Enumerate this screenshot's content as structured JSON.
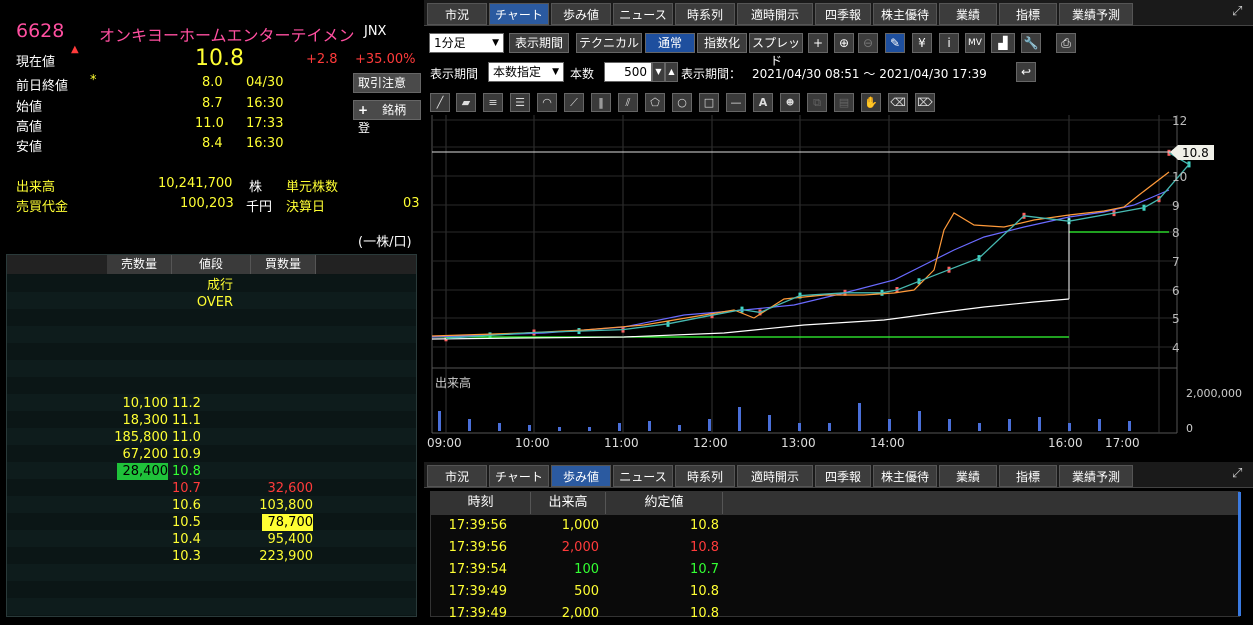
{
  "quote": {
    "code": "6628",
    "name": "オンキヨーホームエンターテイメン",
    "market": "JNX",
    "current_label": "現在値",
    "current": "10.8",
    "change": "+2.8",
    "change_pct": "+35.00%",
    "prev_close_label": "前日終値",
    "prev_mark": "*",
    "prev_close": "8.0",
    "prev_close_date": "04/30",
    "open_label": "始値",
    "open": "8.7",
    "open_time": "16:30",
    "high_label": "高値",
    "high": "11.0",
    "high_time": "17:33",
    "low_label": "安値",
    "low": "8.4",
    "low_time": "16:30",
    "volume_label": "出来高",
    "volume": "10,241,700",
    "volume_unit": "株",
    "unit_shares_label": "単元株数",
    "turnover_label": "売買代金",
    "turnover": "100,203",
    "turnover_unit": "千円",
    "settlement_label": "決算日",
    "settlement_val": "03",
    "unit_note": "(一株/口)",
    "btn_notice": "取引注意",
    "btn_register": "銘柄登",
    "btn_plus": "+"
  },
  "board": {
    "headers": [
      "売数量",
      "値段",
      "買数量"
    ],
    "market_order": "成行",
    "over": "OVER",
    "asks": [
      {
        "qty": "10,100",
        "price": "11.2"
      },
      {
        "qty": "18,300",
        "price": "11.1"
      },
      {
        "qty": "185,800",
        "price": "11.0"
      },
      {
        "qty": "67,200",
        "price": "10.9"
      },
      {
        "qty": "28,400",
        "price": "10.8"
      }
    ],
    "bids": [
      {
        "price": "10.7",
        "qty": "32,600"
      },
      {
        "price": "10.6",
        "qty": "103,800"
      },
      {
        "price": "10.5",
        "qty": "78,700"
      },
      {
        "price": "10.4",
        "qty": "95,400"
      },
      {
        "price": "10.3",
        "qty": "223,900"
      }
    ]
  },
  "tabs": [
    "市況",
    "チャート",
    "歩み値",
    "ニュース",
    "時系列",
    "適時開示",
    "四季報",
    "株主優待",
    "業績",
    "指標",
    "業績予測"
  ],
  "toolbar": {
    "interval": "1分足",
    "period_btn": "表示期間",
    "technical_btn": "テクニカル",
    "normal_btn": "通常",
    "index_btn": "指数化",
    "spread_btn": "スプレッド",
    "period_label": "表示期間",
    "period_mode": "本数指定",
    "count_label": "本数",
    "count": "500",
    "range_label": "表示期間：",
    "range": "2021/04/30 08:51 ～ 2021/04/30 17:39"
  },
  "chart": {
    "yticks": [
      "12",
      "10",
      "9",
      "8",
      "7",
      "6",
      "5",
      "4"
    ],
    "current_tag": "10.8",
    "volume_label": "出来高",
    "volume_tick": "2,000,000",
    "volume_zero": "0",
    "xticks": [
      "09:00",
      "10:00",
      "11:00",
      "12:00",
      "13:00",
      "14:00",
      "16:00",
      "17:00"
    ]
  },
  "chart_data": {
    "type": "line",
    "title": "",
    "xlabel": "",
    "ylabel": "",
    "x": [
      "09:00",
      "09:30",
      "10:00",
      "10:30",
      "11:00",
      "11:30",
      "12:00",
      "12:20",
      "12:35",
      "13:00",
      "13:30",
      "13:55",
      "14:05",
      "14:20",
      "14:40",
      "15:00",
      "15:30",
      "16:00",
      "16:30",
      "16:50",
      "17:00",
      "17:20",
      "17:39"
    ],
    "series": [
      {
        "values": [
          4.3,
          4.4,
          4.5,
          4.55,
          4.6,
          4.8,
          5.1,
          5.3,
          5.2,
          5.8,
          5.9,
          5.9,
          6.0,
          6.3,
          6.7,
          7.1,
          8.6,
          8.4,
          8.7,
          8.9,
          9.2,
          10.4,
          10.8
        ]
      }
    ],
    "ylim": [
      4,
      12
    ]
  },
  "ticks": {
    "headers": [
      "時刻",
      "出来高",
      "約定値"
    ],
    "rows": [
      {
        "time": "17:39:56",
        "vol": "1,000",
        "price": "10.8"
      },
      {
        "time": "17:39:56",
        "vol": "2,000",
        "price": "10.8"
      },
      {
        "time": "17:39:54",
        "vol": "100",
        "price": "10.7"
      },
      {
        "time": "17:39:49",
        "vol": "500",
        "price": "10.8"
      },
      {
        "time": "17:39:49",
        "vol": "2,000",
        "price": "10.8"
      }
    ]
  },
  "colors": {
    "ask": "#ffff33",
    "bid_price": "#ff3b3b",
    "up": "#33ff33",
    "tab_active": "#2b5aa0"
  }
}
